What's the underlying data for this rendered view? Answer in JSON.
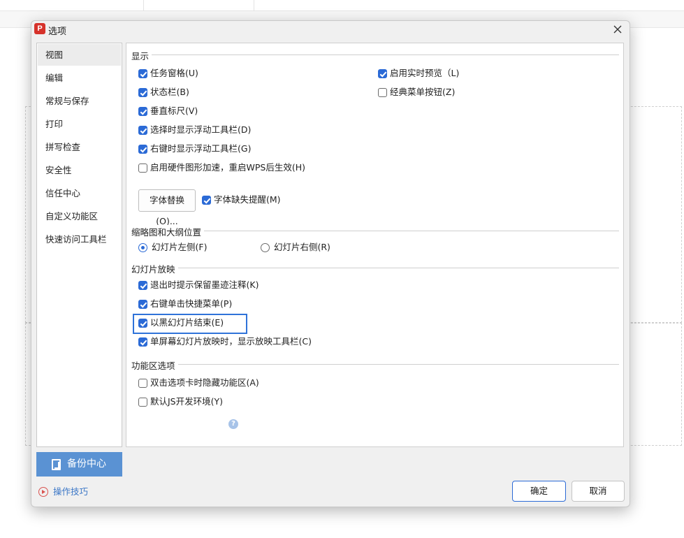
{
  "dialog": {
    "title": "选项",
    "app_icon_letter": "P"
  },
  "nav": {
    "items": [
      {
        "label": "视图"
      },
      {
        "label": "编辑"
      },
      {
        "label": "常规与保存"
      },
      {
        "label": "打印"
      },
      {
        "label": "拼写检查"
      },
      {
        "label": "安全性"
      },
      {
        "label": "信任中心"
      },
      {
        "label": "自定义功能区"
      },
      {
        "label": "快速访问工具栏"
      }
    ],
    "selected": "视图"
  },
  "backup": {
    "label": "备份中心"
  },
  "tips": {
    "label": "操作技巧"
  },
  "sections": {
    "display": {
      "title": "显示",
      "options": [
        {
          "label": "任务窗格(U)",
          "checked": true
        },
        {
          "label": "状态栏(B)",
          "checked": true
        },
        {
          "label": "垂直标尺(V)",
          "checked": true
        },
        {
          "label": "选择时显示浮动工具栏(D)",
          "checked": true
        },
        {
          "label": "右键时显示浮动工具栏(G)",
          "checked": true
        },
        {
          "label": "启用硬件图形加速，重启WPS后生效(H)",
          "checked": false
        }
      ],
      "options_right": [
        {
          "label": "启用实时预览（L)",
          "checked": true
        },
        {
          "label": "经典菜单按钮(Z)",
          "checked": false
        }
      ],
      "font_replace_button": "字体替换(O)...",
      "font_missing_alert": {
        "label": "字体缺失提醒(M)",
        "checked": true
      }
    },
    "thumbnail": {
      "title": "缩略图和大纲位置",
      "radios": [
        {
          "label": "幻灯片左侧(F)",
          "selected": true
        },
        {
          "label": "幻灯片右侧(R)",
          "selected": false
        }
      ]
    },
    "slideshow": {
      "title": "幻灯片放映",
      "options": [
        {
          "label": "退出时提示保留墨迹注释(K)",
          "checked": true
        },
        {
          "label": "右键单击快捷菜单(P)",
          "checked": true
        },
        {
          "label": "以黑幻灯片结束(E)",
          "checked": true
        },
        {
          "label": "单屏幕幻灯片放映时，显示放映工具栏(C)",
          "checked": true
        }
      ]
    },
    "ribbon": {
      "title": "功能区选项",
      "options": [
        {
          "label": "双击选项卡时隐藏功能区(A)",
          "checked": false
        },
        {
          "label": "默认JS开发环境(Y)",
          "checked": false
        }
      ],
      "help_glyph": "?"
    }
  },
  "buttons": {
    "ok": "确定",
    "cancel": "取消"
  },
  "colors": {
    "accent": "#2b6ad6",
    "backup_bg": "#5a92d3",
    "highlight": "#2f73d9"
  }
}
